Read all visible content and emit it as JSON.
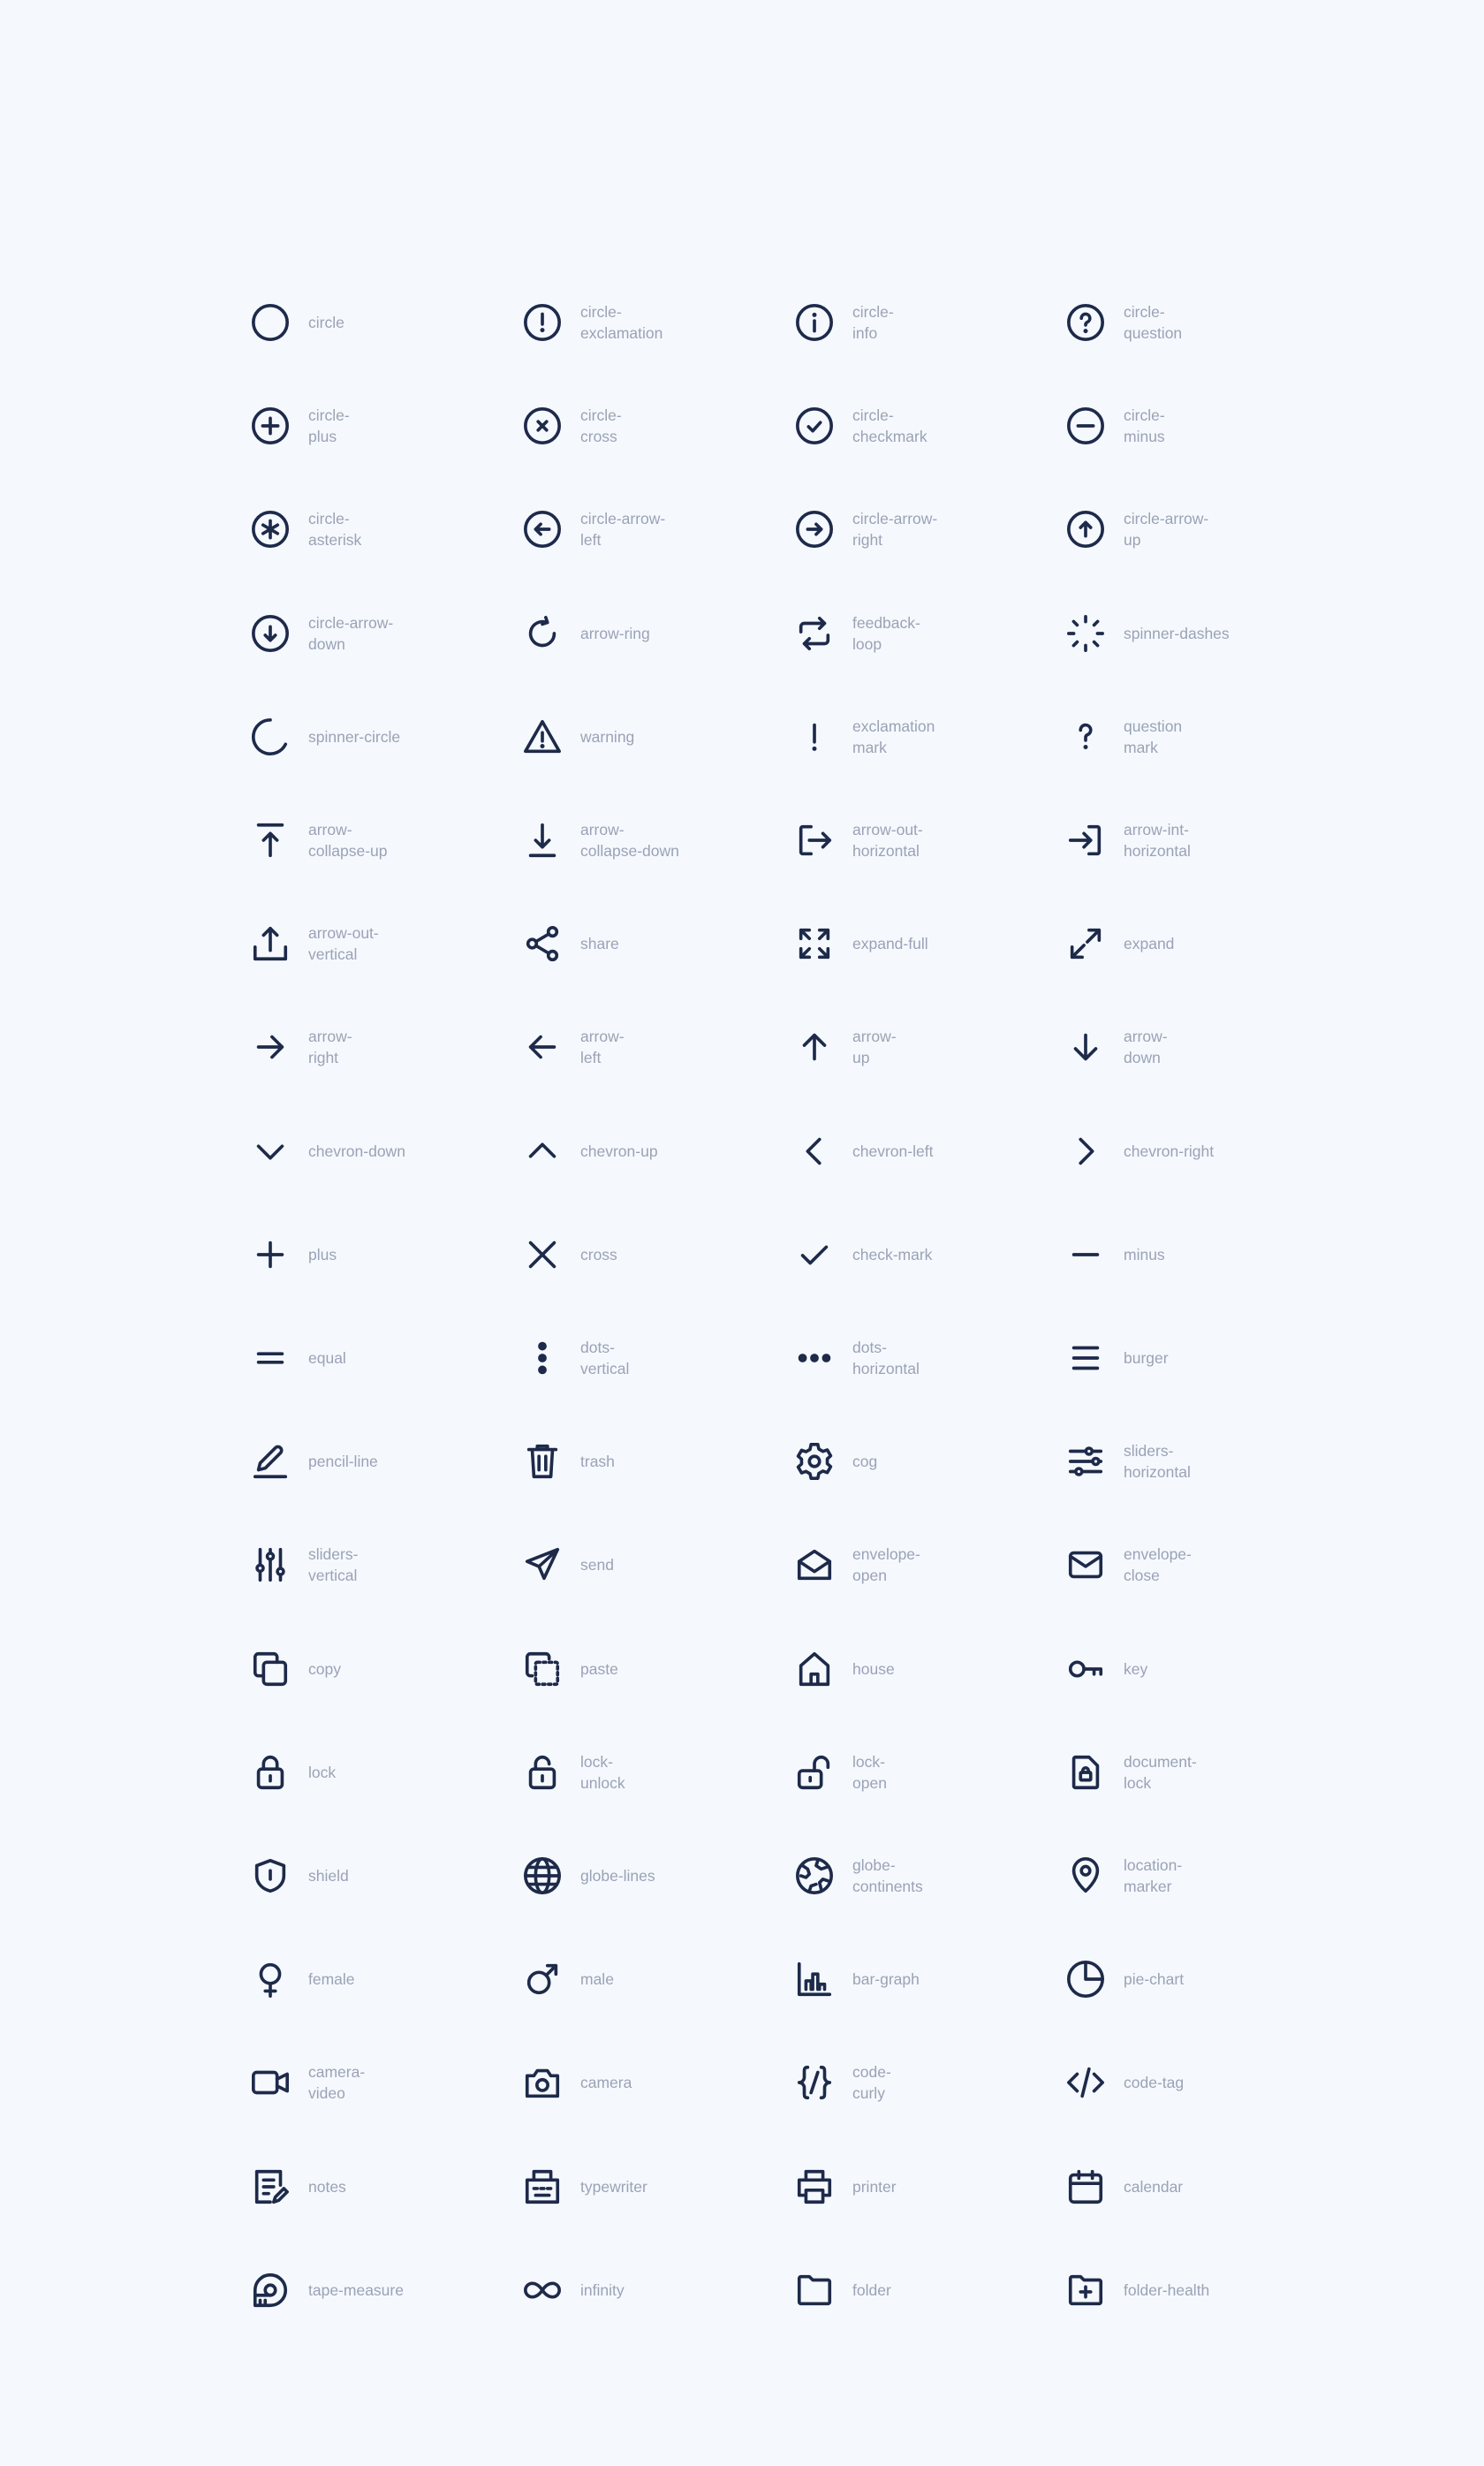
{
  "colors": {
    "background": "#f5f9fd",
    "icon": "#1e2a4a",
    "label": "#9ba2b6"
  },
  "icons": [
    {
      "icon": "circle",
      "label": "circle"
    },
    {
      "icon": "circle-exclamation",
      "label": "circle-\nexclamation"
    },
    {
      "icon": "circle-info",
      "label": "circle-\ninfo"
    },
    {
      "icon": "circle-question",
      "label": "circle-\nquestion"
    },
    {
      "icon": "circle-plus",
      "label": "circle-\nplus"
    },
    {
      "icon": "circle-cross",
      "label": "circle-\ncross"
    },
    {
      "icon": "circle-checkmark",
      "label": "circle-\ncheckmark"
    },
    {
      "icon": "circle-minus",
      "label": "circle-\nminus"
    },
    {
      "icon": "circle-asterisk",
      "label": "circle-\nasterisk"
    },
    {
      "icon": "circle-arrow-left",
      "label": "circle-arrow-\nleft"
    },
    {
      "icon": "circle-arrow-right",
      "label": "circle-arrow-\nright"
    },
    {
      "icon": "circle-arrow-up",
      "label": "circle-arrow-\nup"
    },
    {
      "icon": "circle-arrow-down",
      "label": "circle-arrow-\ndown"
    },
    {
      "icon": "arrow-ring",
      "label": "arrow-ring"
    },
    {
      "icon": "feedback-loop",
      "label": "feedback-\nloop"
    },
    {
      "icon": "spinner-dashes",
      "label": "spinner-dashes"
    },
    {
      "icon": "spinner-circle",
      "label": "spinner-circle"
    },
    {
      "icon": "warning",
      "label": "warning"
    },
    {
      "icon": "exclamation-mark",
      "label": "exclamation\nmark"
    },
    {
      "icon": "question-mark",
      "label": "question\nmark"
    },
    {
      "icon": "arrow-collapse-up",
      "label": "arrow-\ncollapse-up"
    },
    {
      "icon": "arrow-collapse-down",
      "label": "arrow-\ncollapse-down"
    },
    {
      "icon": "arrow-out-horizontal",
      "label": "arrow-out-\nhorizontal"
    },
    {
      "icon": "arrow-int-horizontal",
      "label": "arrow-int-\nhorizontal"
    },
    {
      "icon": "arrow-out-vertical",
      "label": "arrow-out-\nvertical"
    },
    {
      "icon": "share",
      "label": "share"
    },
    {
      "icon": "expand-full",
      "label": "expand-full"
    },
    {
      "icon": "expand",
      "label": "expand"
    },
    {
      "icon": "arrow-right",
      "label": "arrow-\nright"
    },
    {
      "icon": "arrow-left",
      "label": "arrow-\nleft"
    },
    {
      "icon": "arrow-up",
      "label": "arrow-\nup"
    },
    {
      "icon": "arrow-down",
      "label": "arrow-\ndown"
    },
    {
      "icon": "chevron-down",
      "label": "chevron-down"
    },
    {
      "icon": "chevron-up",
      "label": "chevron-up"
    },
    {
      "icon": "chevron-left",
      "label": "chevron-left"
    },
    {
      "icon": "chevron-right",
      "label": "chevron-right"
    },
    {
      "icon": "plus",
      "label": "plus"
    },
    {
      "icon": "cross",
      "label": "cross"
    },
    {
      "icon": "check-mark",
      "label": "check-mark"
    },
    {
      "icon": "minus",
      "label": "minus"
    },
    {
      "icon": "equal",
      "label": "equal"
    },
    {
      "icon": "dots-vertical",
      "label": "dots-\nvertical"
    },
    {
      "icon": "dots-horizontal",
      "label": "dots-\nhorizontal"
    },
    {
      "icon": "burger",
      "label": "burger"
    },
    {
      "icon": "pencil-line",
      "label": "pencil-line"
    },
    {
      "icon": "trash",
      "label": "trash"
    },
    {
      "icon": "cog",
      "label": "cog"
    },
    {
      "icon": "sliders-horizontal",
      "label": "sliders-\nhorizontal"
    },
    {
      "icon": "sliders-vertical",
      "label": "sliders-\nvertical"
    },
    {
      "icon": "send",
      "label": "send"
    },
    {
      "icon": "envelope-open",
      "label": "envelope-\nopen"
    },
    {
      "icon": "envelope-close",
      "label": "envelope-\nclose"
    },
    {
      "icon": "copy",
      "label": "copy"
    },
    {
      "icon": "paste",
      "label": "paste"
    },
    {
      "icon": "house",
      "label": "house"
    },
    {
      "icon": "key",
      "label": "key"
    },
    {
      "icon": "lock",
      "label": "lock"
    },
    {
      "icon": "lock-unlock",
      "label": "lock-\nunlock"
    },
    {
      "icon": "lock-open",
      "label": "lock-\nopen"
    },
    {
      "icon": "document-lock",
      "label": "document-\nlock"
    },
    {
      "icon": "shield",
      "label": "shield"
    },
    {
      "icon": "globe-lines",
      "label": "globe-lines"
    },
    {
      "icon": "globe-continents",
      "label": "globe-\ncontinents"
    },
    {
      "icon": "location-marker",
      "label": "location-\nmarker"
    },
    {
      "icon": "female",
      "label": "female"
    },
    {
      "icon": "male",
      "label": "male"
    },
    {
      "icon": "bar-graph",
      "label": "bar-graph"
    },
    {
      "icon": "pie-chart",
      "label": "pie-chart"
    },
    {
      "icon": "camera-video",
      "label": "camera-\nvideo"
    },
    {
      "icon": "camera",
      "label": "camera"
    },
    {
      "icon": "code-curly",
      "label": "code-\ncurly"
    },
    {
      "icon": "code-tag",
      "label": "code-tag"
    },
    {
      "icon": "notes",
      "label": "notes"
    },
    {
      "icon": "typewriter",
      "label": "typewriter"
    },
    {
      "icon": "printer",
      "label": "printer"
    },
    {
      "icon": "calendar",
      "label": "calendar"
    },
    {
      "icon": "tape-measure",
      "label": "tape-measure"
    },
    {
      "icon": "infinity",
      "label": "infinity"
    },
    {
      "icon": "folder",
      "label": "folder"
    },
    {
      "icon": "folder-health",
      "label": "folder-health"
    }
  ]
}
